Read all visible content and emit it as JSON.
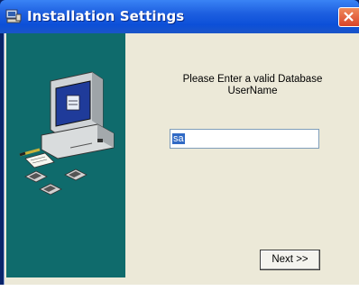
{
  "window": {
    "title": "Installation Settings",
    "app_icon": "setup-computer-icon",
    "close_icon": "close-icon",
    "colors": {
      "titlebar": "#0c4fd8",
      "side_panel": "#0f6b6c",
      "client": "#ece9d8",
      "close": "#d9442a"
    }
  },
  "main": {
    "prompt": "Please Enter a valid Database UserName",
    "username_value": "sa",
    "next_label": "Next >>"
  },
  "art": {
    "icons": [
      "computer-icon",
      "pen-icon",
      "document-icon",
      "floppy-disk-icon"
    ]
  }
}
